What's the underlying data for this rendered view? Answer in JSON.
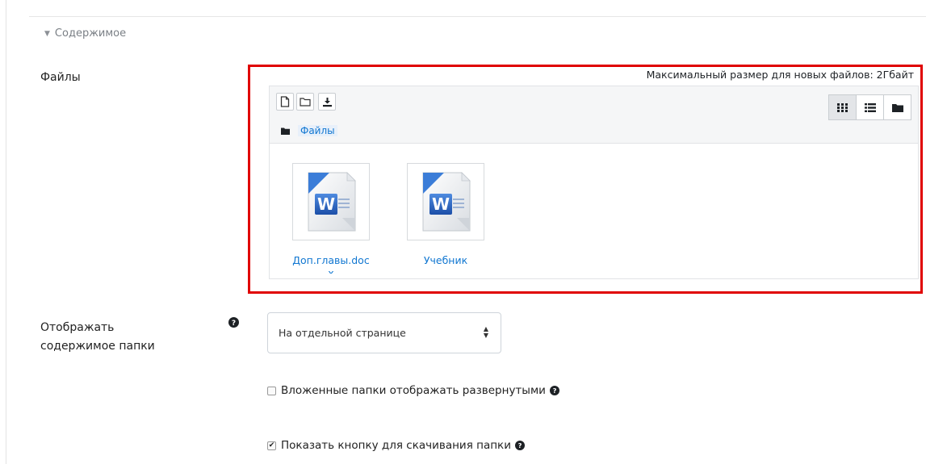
{
  "section": {
    "title": "Содержимое",
    "icon": "triangle-down-icon"
  },
  "files_field": {
    "label": "Файлы",
    "max_size_text": "Максимальный размер для новых файлов: 2Гбайт",
    "toolbar": {
      "buttons": [
        "add-file-icon",
        "create-folder-icon",
        "download-icon"
      ],
      "views": [
        "view-icons-icon",
        "view-list-icon",
        "view-tree-icon"
      ],
      "active_view": "view-icons-icon"
    },
    "breadcrumb": "Файлы",
    "files": [
      {
        "name": "Доп.главы.doc",
        "name_cut": "x",
        "icon": "word-doc-icon"
      },
      {
        "name": "Учебник",
        "name_cut": "...",
        "icon": "word-doc-icon"
      }
    ]
  },
  "display_field": {
    "label_line1": "Отображать",
    "label_line2": "содержимое папки",
    "selected": "На отдельной странице"
  },
  "checkboxes": [
    {
      "label": "Вложенные папки отображать развернутыми",
      "checked": false
    },
    {
      "label": "Показать кнопку для скачивания папки",
      "checked": true
    }
  ],
  "colors": {
    "highlight": "#e00000",
    "link": "#1177d1",
    "help_icon": "#1d2125"
  }
}
